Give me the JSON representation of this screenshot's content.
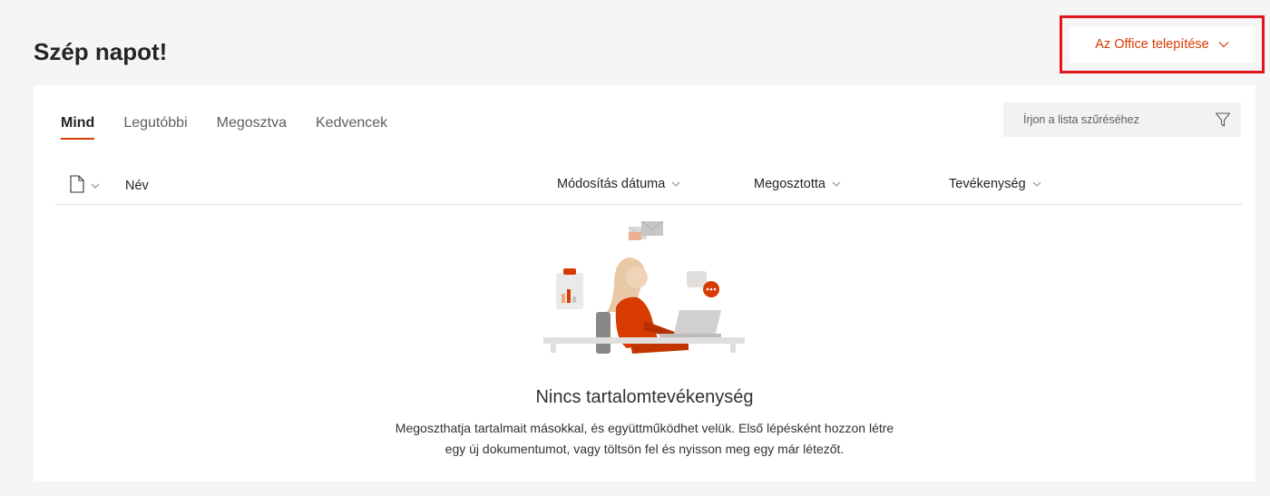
{
  "header": {
    "greeting": "Szép napot!",
    "install_button_label": "Az Office telepítése"
  },
  "tabs": [
    {
      "label": "Mind",
      "active": true
    },
    {
      "label": "Legutóbbi",
      "active": false
    },
    {
      "label": "Megosztva",
      "active": false
    },
    {
      "label": "Kedvencek",
      "active": false
    }
  ],
  "filter": {
    "placeholder": "Írjon a lista szűréséhez"
  },
  "columns": {
    "name": "Név",
    "modified": "Módosítás dátuma",
    "shared_by": "Megosztotta",
    "activity": "Tevékenység"
  },
  "empty_state": {
    "title": "Nincs tartalomtevékenység",
    "description_line1": "Megoszthatja tartalmait másokkal, és együttműködhet velük. Első lépésként hozzon létre",
    "description_line2": "egy új dokumentumot, vagy töltsön fel és nyisson meg egy már létezőt."
  },
  "colors": {
    "accent": "#d83b01",
    "highlight_box": "#e2141d",
    "background": "#f5f5f5",
    "card": "#ffffff"
  }
}
